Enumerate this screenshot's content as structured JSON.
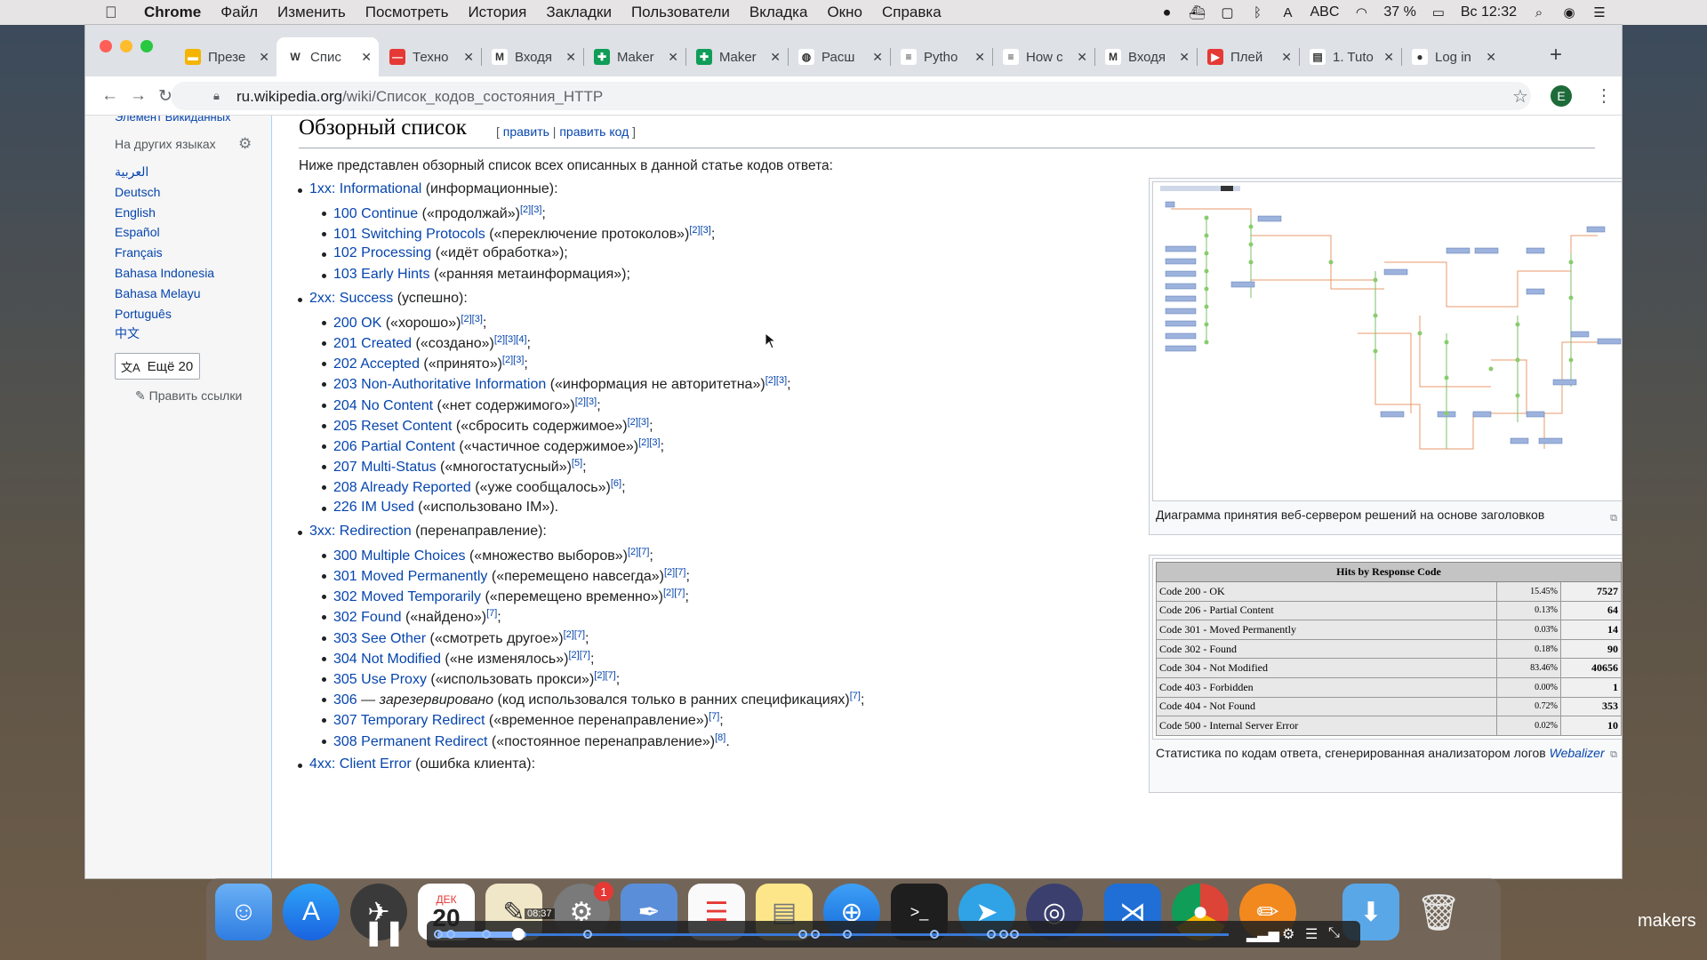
{
  "menubar": {
    "app": "Chrome",
    "items": [
      "Файл",
      "Изменить",
      "Посмотреть",
      "История",
      "Закладки",
      "Пользователи",
      "Вкладка",
      "Окно",
      "Справка"
    ],
    "keyboard": "ABC",
    "battery": "37 %",
    "clock": "Вс 12:32"
  },
  "tabs": [
    {
      "label": "Презе",
      "icon": "slides-icon",
      "color": "#f4b400",
      "glyph": "▬"
    },
    {
      "label": "Спис",
      "icon": "wikipedia-icon",
      "color": "#ffffff",
      "glyph": "W"
    },
    {
      "label": "Техно",
      "icon": "techno-icon",
      "color": "#e53935",
      "glyph": "—"
    },
    {
      "label": "Входя",
      "icon": "gmail-icon",
      "color": "#ffffff",
      "glyph": "M"
    },
    {
      "label": "Maker",
      "icon": "sheets-icon",
      "color": "#0f9d58",
      "glyph": "✚"
    },
    {
      "label": "Maker",
      "icon": "sheets-icon",
      "color": "#0f9d58",
      "glyph": "✚"
    },
    {
      "label": "Расш",
      "icon": "globe-icon",
      "color": "#ffffff",
      "glyph": "◍"
    },
    {
      "label": "Pytho",
      "icon": "stackoverflow-icon",
      "color": "#ffffff",
      "glyph": "≡"
    },
    {
      "label": "How c",
      "icon": "stackoverflow-icon",
      "color": "#ffffff",
      "glyph": "≡"
    },
    {
      "label": "Входя",
      "icon": "gmail-icon",
      "color": "#ffffff",
      "glyph": "M"
    },
    {
      "label": "Плей",
      "icon": "youtube-icon",
      "color": "#e53935",
      "glyph": "▶"
    },
    {
      "label": "1. Tuto",
      "icon": "doc-icon",
      "color": "#ffffff",
      "glyph": "▤"
    },
    {
      "label": "Log in",
      "icon": "leaf-icon",
      "color": "#ffffff",
      "glyph": "●"
    }
  ],
  "address": {
    "host": "ru.wikipedia.org",
    "path": "/wiki/Список_кодов_состояния_HTTP",
    "profile_initial": "E"
  },
  "sidebar": {
    "cutoff": "Элемент Викиданных",
    "lang_header": "На других языках",
    "languages": [
      "العربية",
      "Deutsch",
      "English",
      "Español",
      "Français",
      "Bahasa Indonesia",
      "Bahasa Melayu",
      "Português",
      "中文"
    ],
    "more_label": "Ещё 20",
    "edit_links": "Править ссылки"
  },
  "section": {
    "title": "Обзорный список",
    "edit": "править",
    "edit_code": "править код",
    "intro": "Ниже представлен обзорный список всех описанных в данной статье кодов ответа:"
  },
  "groups": [
    {
      "link": "1xx: Informational",
      "desc": " (информационные):",
      "items": [
        {
          "link": "100 Continue",
          "desc": " («продолжай»)",
          "refs": "[2][3]",
          "tail": ";"
        },
        {
          "link": "101 Switching Protocols",
          "desc": " («переключение протоколов»)",
          "refs": "[2][3]",
          "tail": ";"
        },
        {
          "link": "102 Processing",
          "desc": " («идёт обработка»);",
          "refs": "",
          "tail": ""
        },
        {
          "link": "103 Early Hints",
          "desc": " («ранняя метаинформация»);",
          "refs": "",
          "tail": ""
        }
      ]
    },
    {
      "link": "2xx: Success",
      "desc": " (успешно):",
      "items": [
        {
          "link": "200 OK",
          "desc": " («хорошо»)",
          "refs": "[2][3]",
          "tail": ";"
        },
        {
          "link": "201 Created",
          "desc": " («создано»)",
          "refs": "[2][3][4]",
          "tail": ";"
        },
        {
          "link": "202 Accepted",
          "desc": " («принято»)",
          "refs": "[2][3]",
          "tail": ";"
        },
        {
          "link": "203 Non-Authoritative Information",
          "desc": " («информация не авторитетна»)",
          "refs": "[2][3]",
          "tail": ";"
        },
        {
          "link": "204 No Content",
          "desc": " («нет содержимого»)",
          "refs": "[2][3]",
          "tail": ";"
        },
        {
          "link": "205 Reset Content",
          "desc": " («сбросить содержимое»)",
          "refs": "[2][3]",
          "tail": ";"
        },
        {
          "link": "206 Partial Content",
          "desc": " («частичное содержимое»)",
          "refs": "[2][3]",
          "tail": ";"
        },
        {
          "link": "207 Multi-Status",
          "desc": " («многостатусный»)",
          "refs": "[5]",
          "tail": ";"
        },
        {
          "link": "208 Already Reported",
          "desc": " («уже сообщалось»)",
          "refs": "[6]",
          "tail": ";"
        },
        {
          "link": "226 IM Used",
          "desc": " («использовано IM»).",
          "refs": "",
          "tail": ""
        }
      ]
    },
    {
      "link": "3xx: Redirection",
      "desc": " (перенаправление):",
      "items": [
        {
          "link": "300 Multiple Choices",
          "desc": " («множество выборов»)",
          "refs": "[2][7]",
          "tail": ";"
        },
        {
          "link": "301 Moved Permanently",
          "desc": " («перемещено навсегда»)",
          "refs": "[2][7]",
          "tail": ";"
        },
        {
          "link": "302 Moved Temporarily",
          "desc": " («перемещено временно»)",
          "refs": "[2][7]",
          "tail": ";"
        },
        {
          "link": "302 Found",
          "desc": " («найдено»)",
          "refs": "[7]",
          "tail": ";"
        },
        {
          "link": "303 See Other",
          "desc": " («смотреть другое»)",
          "refs": "[2][7]",
          "tail": ";"
        },
        {
          "link": "304 Not Modified",
          "desc": " («не изменялось»)",
          "refs": "[2][7]",
          "tail": ";"
        },
        {
          "link": "305 Use Proxy",
          "desc": " («использовать прокси»)",
          "refs": "[2][7]",
          "tail": ";"
        },
        {
          "link": "306",
          "desc": " — ",
          "italic": "зарезервировано",
          "desc2": " (код использовался только в ранних спецификациях)",
          "refs": "[7]",
          "tail": ";"
        },
        {
          "link": "307 Temporary Redirect",
          "desc": " («временное перенаправление»)",
          "refs": "[7]",
          "tail": ";"
        },
        {
          "link": "308 Permanent Redirect",
          "desc": " («постоянное перенаправление»)",
          "refs": "[8]",
          "tail": "."
        }
      ]
    },
    {
      "link": "4xx: Client Error",
      "desc": " (ошибка клиента):",
      "items": []
    }
  ],
  "figure1": {
    "caption": "Диаграмма принятия веб-сервером решений на основе заголовков"
  },
  "figure2": {
    "table_title": "Hits by Response Code",
    "rows": [
      {
        "label": "Code 200 - OK",
        "pct": "15.45%",
        "count": "7527"
      },
      {
        "label": "Code 206 - Partial Content",
        "pct": "0.13%",
        "count": "64"
      },
      {
        "label": "Code 301 - Moved Permanently",
        "pct": "0.03%",
        "count": "14"
      },
      {
        "label": "Code 302 - Found",
        "pct": "0.18%",
        "count": "90"
      },
      {
        "label": "Code 304 - Not Modified",
        "pct": "83.46%",
        "count": "40656"
      },
      {
        "label": "Code 403 - Forbidden",
        "pct": "0.00%",
        "count": "1"
      },
      {
        "label": "Code 404 - Not Found",
        "pct": "0.72%",
        "count": "353"
      },
      {
        "label": "Code 500 - Internal Server Error",
        "pct": "0.02%",
        "count": "10"
      }
    ],
    "caption": "Статистика по кодам ответа, сгенерированная анализатором логов ",
    "caption_link": "Webalizer"
  },
  "dock": {
    "calendar_month": "ДЕК",
    "calendar_day": "20",
    "notification_count": "1"
  },
  "video": {
    "time": "08:37"
  },
  "watermark": "makers"
}
